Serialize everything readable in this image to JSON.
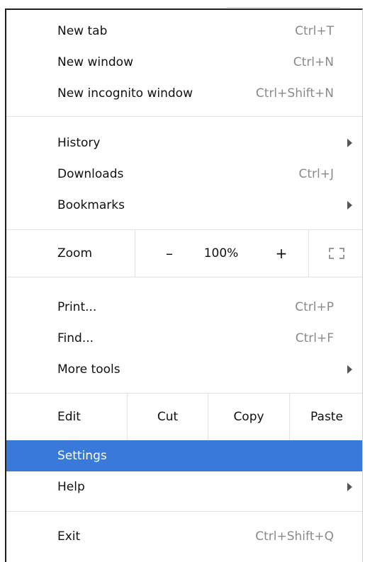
{
  "menu": {
    "new_tab": {
      "label": "New tab",
      "shortcut": "Ctrl+T"
    },
    "new_window": {
      "label": "New window",
      "shortcut": "Ctrl+N"
    },
    "new_incognito": {
      "label": "New incognito window",
      "shortcut": "Ctrl+Shift+N"
    },
    "history": {
      "label": "History"
    },
    "downloads": {
      "label": "Downloads",
      "shortcut": "Ctrl+J"
    },
    "bookmarks": {
      "label": "Bookmarks"
    },
    "zoom": {
      "label": "Zoom",
      "minus": "–",
      "level": "100%",
      "plus": "+",
      "fullscreen_icon": "fullscreen-icon"
    },
    "print": {
      "label": "Print...",
      "shortcut": "Ctrl+P"
    },
    "find": {
      "label": "Find...",
      "shortcut": "Ctrl+F"
    },
    "more_tools": {
      "label": "More tools"
    },
    "edit": {
      "label": "Edit",
      "cut": "Cut",
      "copy": "Copy",
      "paste": "Paste"
    },
    "settings": {
      "label": "Settings"
    },
    "help": {
      "label": "Help"
    },
    "exit": {
      "label": "Exit",
      "shortcut": "Ctrl+Shift+Q"
    }
  },
  "colors": {
    "highlight": "#3879d9",
    "shortcut_text": "#8a8a8a",
    "separator": "#e2e2e2"
  }
}
